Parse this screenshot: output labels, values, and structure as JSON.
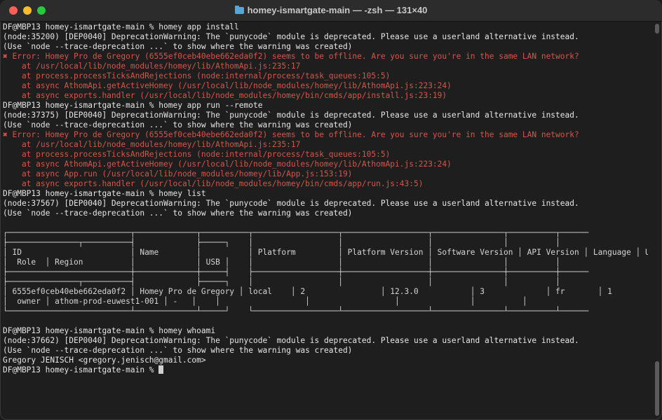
{
  "window": {
    "title": "homey-ismartgate-main — -zsh — 131×40",
    "folder_icon": "folder-icon"
  },
  "terminal": {
    "lines": [
      {
        "t": "DF@MBP13 homey-ismartgate-main % homey app install",
        "k": "cmd"
      },
      {
        "t": "(node:35200) [DEP0040] DeprecationWarning: The `punycode` module is deprecated. Please use a userland alternative instead.",
        "k": "out"
      },
      {
        "t": "(Use `node --trace-deprecation ...` to show where the warning was created)",
        "k": "out"
      },
      {
        "t": "✖ Error: Homey Pro de Gregory (6555ef0ceb40ebe662eda0f2) seems to be offline. Are you sure you're in the same LAN network?",
        "k": "err"
      },
      {
        "t": "    at /usr/local/lib/node_modules/homey/lib/AthomApi.js:235:17",
        "k": "err"
      },
      {
        "t": "    at process.processTicksAndRejections (node:internal/process/task_queues:105:5)",
        "k": "err"
      },
      {
        "t": "    at async AthomApi.getActiveHomey (/usr/local/lib/node_modules/homey/lib/AthomApi.js:223:24)",
        "k": "err"
      },
      {
        "t": "    at async exports.handler (/usr/local/lib/node_modules/homey/bin/cmds/app/install.js:23:19)",
        "k": "err"
      },
      {
        "t": "DF@MBP13 homey-ismartgate-main % homey app run --remote",
        "k": "cmd"
      },
      {
        "t": "(node:37375) [DEP0040] DeprecationWarning: The `punycode` module is deprecated. Please use a userland alternative instead.",
        "k": "out"
      },
      {
        "t": "(Use `node --trace-deprecation ...` to show where the warning was created)",
        "k": "out"
      },
      {
        "t": "✖ Error: Homey Pro de Gregory (6555ef0ceb40ebe662eda0f2) seems to be offline. Are you sure you're in the same LAN network?",
        "k": "err"
      },
      {
        "t": "    at /usr/local/lib/node_modules/homey/lib/AthomApi.js:235:17",
        "k": "err"
      },
      {
        "t": "    at process.processTicksAndRejections (node:internal/process/task_queues:105:5)",
        "k": "err"
      },
      {
        "t": "    at async AthomApi.getActiveHomey (/usr/local/lib/node_modules/homey/lib/AthomApi.js:223:24)",
        "k": "err"
      },
      {
        "t": "    at async App.run (/usr/local/lib/node_modules/homey/lib/App.js:153:19)",
        "k": "err"
      },
      {
        "t": "    at async exports.handler (/usr/local/lib/node_modules/homey/bin/cmds/app/run.js:43:5)",
        "k": "err"
      },
      {
        "t": "DF@MBP13 homey-ismartgate-main % homey list",
        "k": "cmd"
      },
      {
        "t": "(node:37567) [DEP0040] DeprecationWarning: The `punycode` module is deprecated. Please use a userland alternative instead.",
        "k": "out"
      },
      {
        "t": "(Use `node --trace-deprecation ...` to show where the warning was created)",
        "k": "out"
      },
      {
        "t": "",
        "k": "out"
      },
      {
        "t": "┌──────────────────────────┬─────────────┬──────────┬──────────────────┬──────────────────┬───────────────┬──────────┬──────",
        "k": "tbl"
      },
      {
        "t": "├───────────────┬──────────┤             ├─────┐    │                  │                  │               │          │",
        "k": "tbl"
      },
      {
        "t": "│ ID                       │ Name        │          │ Platform         │ Platform Version │ Software Version │ API Version │ Language │ Users",
        "k": "tbl"
      },
      {
        "t": "│  Role  │ Region          │             │ USB │    │                  │                  │               │          │",
        "k": "tbl"
      },
      {
        "t": "├──────────────────────────┼─────────────┼─────┤    ├──────────────────┼──────────────────┼───────────────┼──────────┼──────",
        "k": "tbl"
      },
      {
        "t": "├───────────────┬──────────┤             ├─────┐    │                  │                  │               │          │",
        "k": "tbl"
      },
      {
        "t": "│ 6555ef0ceb40ebe662eda0f2 │ Homey Pro de Gregory │ local    │ 2                │ 12.3.0           │ 3             │ fr       │ 1",
        "k": "tbl"
      },
      {
        "t": "│  owner │ athom-prod-euwest1-001 │ -   │    │                  │                  │               │          │",
        "k": "tbl"
      },
      {
        "t": "└──────────────────────────┴─────────────┴─────┘    └──────────────────┴──────────────────┴───────────────┴──────────┴──────",
        "k": "tbl"
      },
      {
        "t": "",
        "k": "out"
      },
      {
        "t": "DF@MBP13 homey-ismartgate-main % homey whoami",
        "k": "cmd"
      },
      {
        "t": "(node:37662) [DEP0040] DeprecationWarning: The `punycode` module is deprecated. Please use a userland alternative instead.",
        "k": "out"
      },
      {
        "t": "(Use `node --trace-deprecation ...` to show where the warning was created)",
        "k": "out"
      },
      {
        "t": "Gregory JENISCH <gregory.jenisch@gmail.com>",
        "k": "out"
      },
      {
        "t": "DF@MBP13 homey-ismartgate-main % ",
        "k": "prompt"
      }
    ]
  },
  "colors": {
    "error": "#d2574a",
    "text": "#e6e6e6",
    "background": "#1e1e1e"
  }
}
